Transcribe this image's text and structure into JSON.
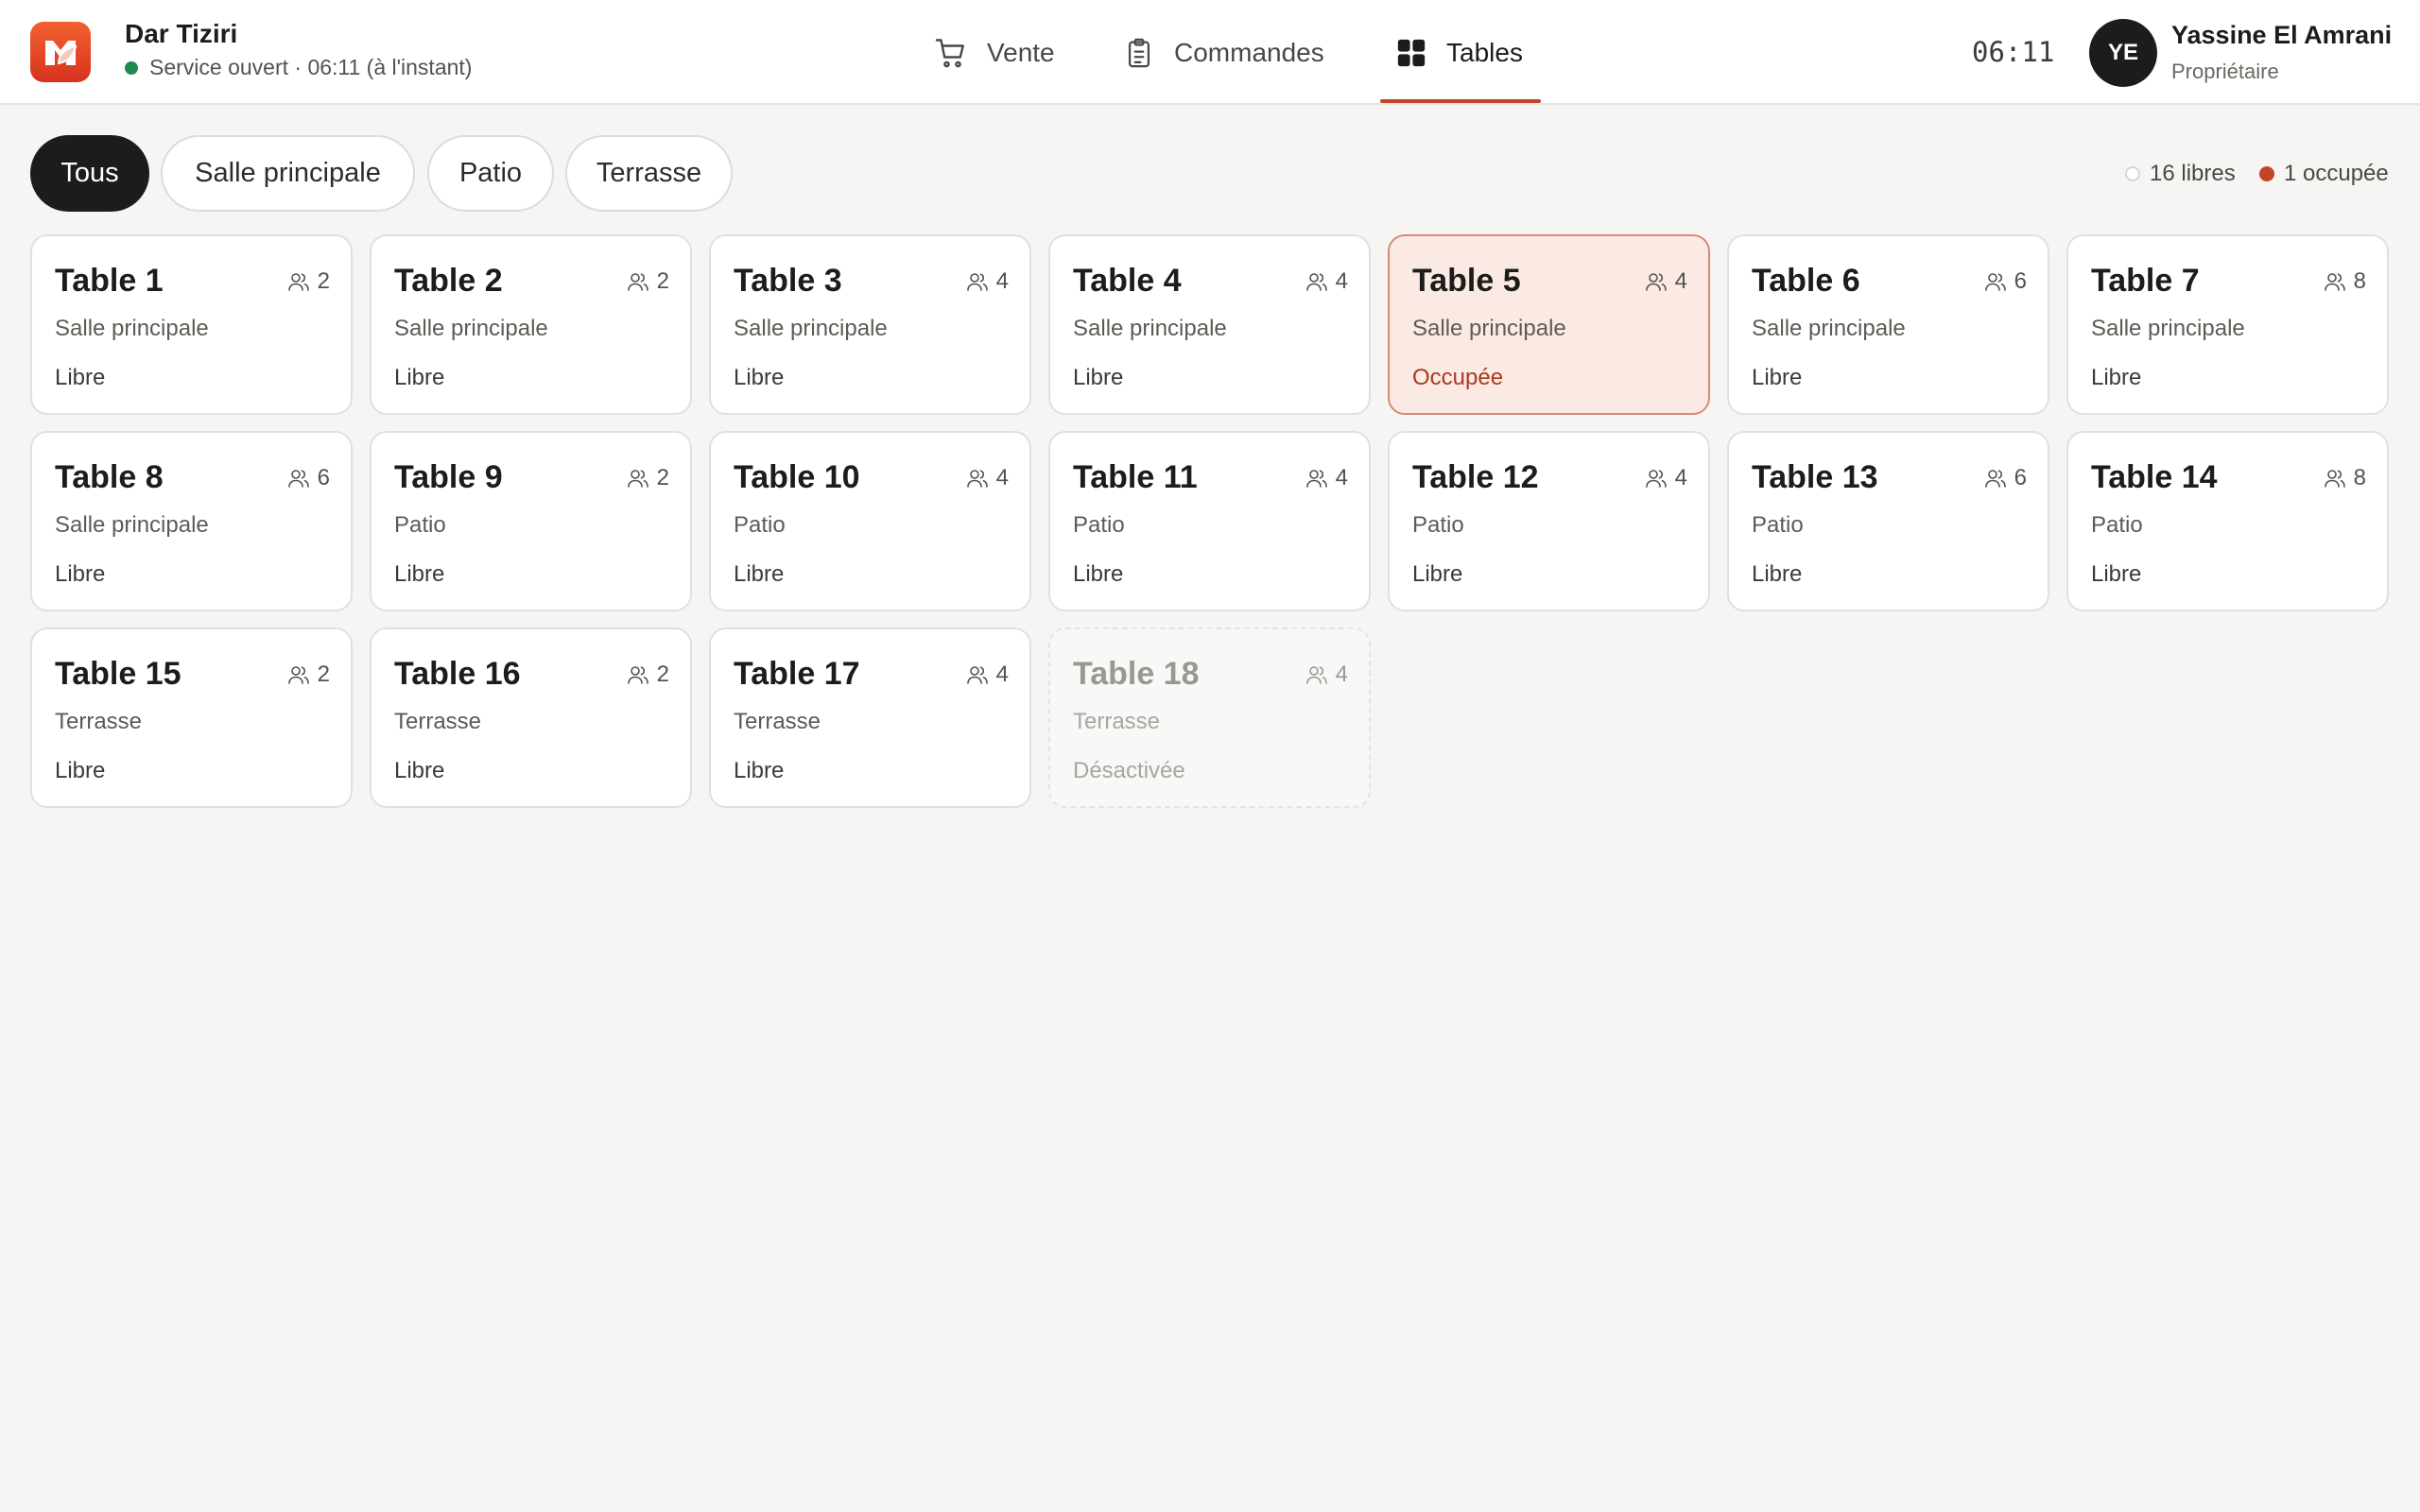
{
  "header": {
    "brand_name": "Dar Tiziri",
    "brand_status": "Service ouvert · 06:11 (à l'instant)",
    "nav": [
      {
        "label": "Vente",
        "icon": "cart-icon"
      },
      {
        "label": "Commandes",
        "icon": "clipboard-icon"
      },
      {
        "label": "Tables",
        "icon": "grid-icon",
        "active": true
      }
    ],
    "clock": "06:11",
    "user": {
      "initials": "YE",
      "name": "Yassine El Amrani",
      "role": "Propriétaire"
    }
  },
  "filters": [
    {
      "label": "Tous",
      "active": true
    },
    {
      "label": "Salle principale"
    },
    {
      "label": "Patio"
    },
    {
      "label": "Terrasse"
    }
  ],
  "legend": {
    "free": "16 libres",
    "occupied": "1 occupée"
  },
  "tables": [
    {
      "name": "Table 1",
      "capacity": "2",
      "zone": "Salle principale",
      "status": "Libre",
      "state": "free"
    },
    {
      "name": "Table 2",
      "capacity": "2",
      "zone": "Salle principale",
      "status": "Libre",
      "state": "free"
    },
    {
      "name": "Table 3",
      "capacity": "4",
      "zone": "Salle principale",
      "status": "Libre",
      "state": "free"
    },
    {
      "name": "Table 4",
      "capacity": "4",
      "zone": "Salle principale",
      "status": "Libre",
      "state": "free"
    },
    {
      "name": "Table 5",
      "capacity": "4",
      "zone": "Salle principale",
      "status": "Occupée",
      "state": "occupied"
    },
    {
      "name": "Table 6",
      "capacity": "6",
      "zone": "Salle principale",
      "status": "Libre",
      "state": "free"
    },
    {
      "name": "Table 7",
      "capacity": "8",
      "zone": "Salle principale",
      "status": "Libre",
      "state": "free"
    },
    {
      "name": "Table 8",
      "capacity": "6",
      "zone": "Salle principale",
      "status": "Libre",
      "state": "free"
    },
    {
      "name": "Table 9",
      "capacity": "2",
      "zone": "Patio",
      "status": "Libre",
      "state": "free"
    },
    {
      "name": "Table 10",
      "capacity": "4",
      "zone": "Patio",
      "status": "Libre",
      "state": "free"
    },
    {
      "name": "Table 11",
      "capacity": "4",
      "zone": "Patio",
      "status": "Libre",
      "state": "free"
    },
    {
      "name": "Table 12",
      "capacity": "4",
      "zone": "Patio",
      "status": "Libre",
      "state": "free"
    },
    {
      "name": "Table 13",
      "capacity": "6",
      "zone": "Patio",
      "status": "Libre",
      "state": "free"
    },
    {
      "name": "Table 14",
      "capacity": "8",
      "zone": "Patio",
      "status": "Libre",
      "state": "free"
    },
    {
      "name": "Table 15",
      "capacity": "2",
      "zone": "Terrasse",
      "status": "Libre",
      "state": "free"
    },
    {
      "name": "Table 16",
      "capacity": "2",
      "zone": "Terrasse",
      "status": "Libre",
      "state": "free"
    },
    {
      "name": "Table 17",
      "capacity": "4",
      "zone": "Terrasse",
      "status": "Libre",
      "state": "free"
    },
    {
      "name": "Table 18",
      "capacity": "4",
      "zone": "Terrasse",
      "status": "Désactivée",
      "state": "disabled"
    }
  ],
  "colors": {
    "accent": "#c4442a",
    "status_open": "#1f8a4c",
    "dark": "#1c1c1a"
  }
}
